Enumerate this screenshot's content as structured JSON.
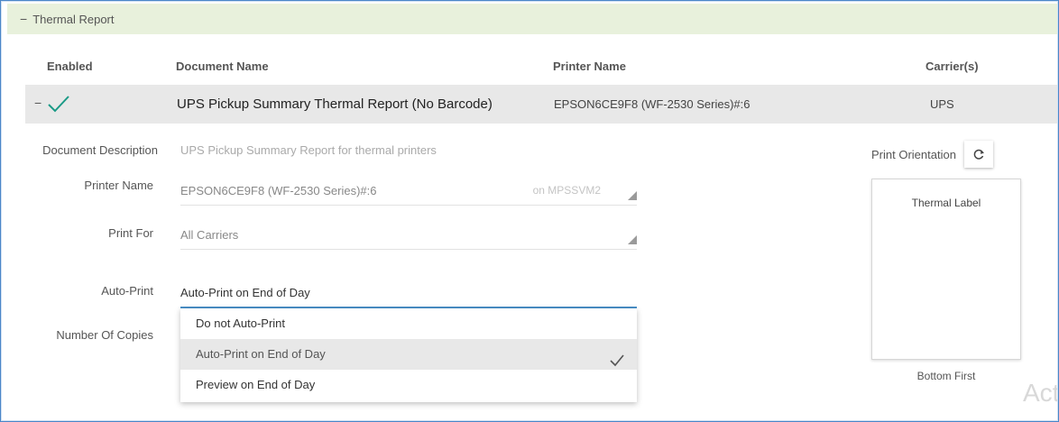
{
  "section": {
    "toggle": "−",
    "title": "Thermal Report"
  },
  "table": {
    "headers": {
      "enabled": "Enabled",
      "document_name": "Document Name",
      "printer_name": "Printer Name",
      "carriers": "Carrier(s)"
    },
    "row": {
      "collapse": "−",
      "enabled_icon": "check-icon",
      "document_name": "UPS Pickup Summary Thermal Report (No Barcode)",
      "printer_name": "EPSON6CE9F8 (WF-2530 Series)#:6",
      "carrier": "UPS"
    }
  },
  "detail": {
    "document_description_label": "Document Description",
    "document_description_value": "UPS Pickup Summary Report for thermal printers",
    "printer_name_label": "Printer Name",
    "printer_name_value": "EPSON6CE9F8 (WF-2530 Series)#:6",
    "printer_server": "on MPSSVM2",
    "print_for_label": "Print For",
    "print_for_value": "All Carriers",
    "auto_print_label": "Auto-Print",
    "auto_print_value": "Auto-Print on End of Day",
    "number_of_copies_label": "Number Of Copies",
    "auto_print_options": [
      {
        "label": "Do not Auto-Print",
        "selected": false
      },
      {
        "label": "Auto-Print on End of Day",
        "selected": true
      },
      {
        "label": "Preview on End of Day",
        "selected": false
      }
    ],
    "print_orientation_label": "Print Orientation",
    "preview_title": "Thermal Label",
    "orientation_caption": "Bottom First"
  },
  "watermark": "Act",
  "colors": {
    "header_bg": "#e8f1dc",
    "check": "#1a9a86",
    "active_underline": "#4a90c8",
    "frame_border": "#4a86c8"
  }
}
